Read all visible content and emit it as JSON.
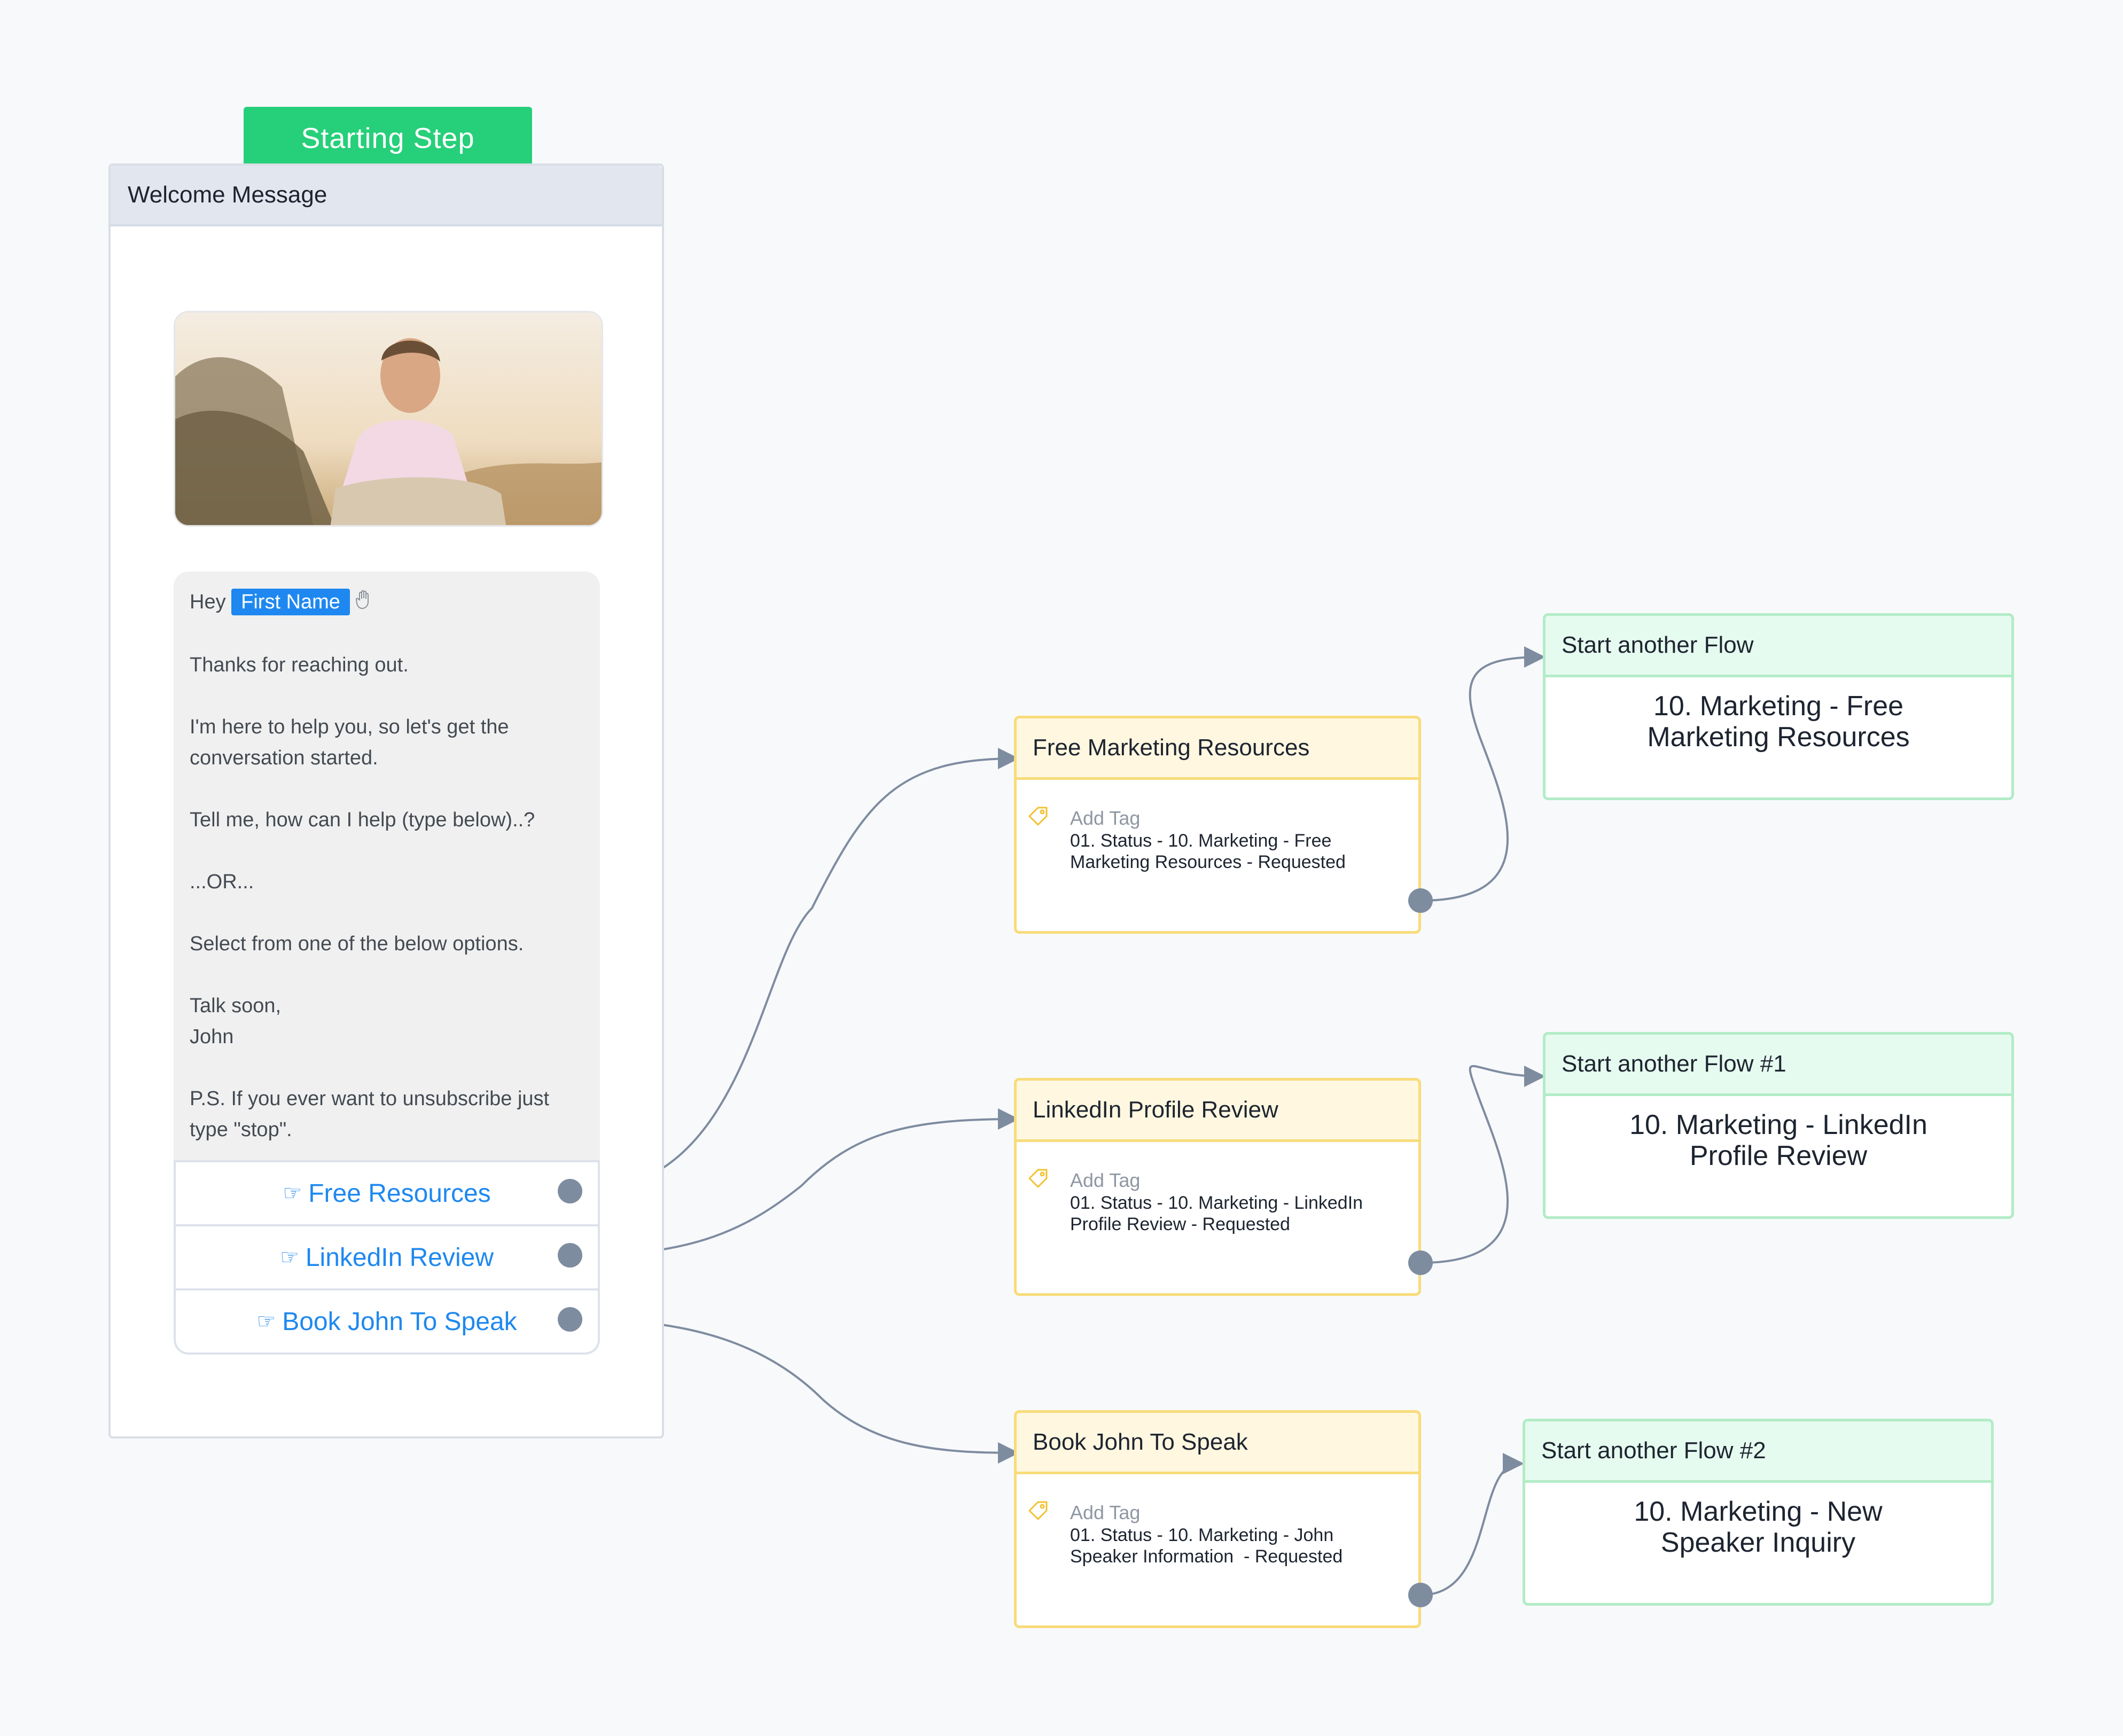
{
  "starting_step": {
    "label": "Starting Step"
  },
  "welcome": {
    "title": "Welcome Message",
    "greeting": "Hey",
    "first_name_placeholder": "First Name",
    "lines": [
      "Thanks for reaching out.",
      "I'm here to help you, so let's get the conversation started.",
      "Tell me, how can I help (type below)..?",
      "...OR...",
      "Select from one of the below options.",
      "Talk soon,\nJohn",
      "P.S. If you ever want to unsubscribe just type \"stop\"."
    ],
    "buttons": [
      {
        "label": "Free Resources",
        "icon": "pointing-hand-icon"
      },
      {
        "label": "LinkedIn Review",
        "icon": "pointing-hand-icon"
      },
      {
        "label": "Book John To Speak",
        "icon": "pointing-hand-icon"
      }
    ]
  },
  "actions": [
    {
      "title": "Free Marketing Resources",
      "tag_label": "Add Tag",
      "tag_value": "01. Status - 10. Marketing - Free Marketing Resources - Requested"
    },
    {
      "title": "LinkedIn Profile Review",
      "tag_label": "Add Tag",
      "tag_value": "01. Status - 10. Marketing - LinkedIn Profile Review - Requested"
    },
    {
      "title": "Book John To Speak",
      "tag_label": "Add Tag",
      "tag_value": "01. Status - 10. Marketing - John Speaker Information  - Requested"
    }
  ],
  "flows": [
    {
      "title": "Start another Flow",
      "flow_name": "10. Marketing - Free Marketing Resources"
    },
    {
      "title": "Start another Flow #1",
      "flow_name": "10. Marketing - LinkedIn Profile Review"
    },
    {
      "title": "Start another Flow #2",
      "flow_name": "10. Marketing - New Speaker Inquiry"
    }
  ],
  "colors": {
    "start_green": "#26cf79",
    "link_blue": "#1e88f0",
    "action_border": "#f8dc7a",
    "flow_border": "#b2ecc7",
    "connector": "#7e8ca0"
  }
}
